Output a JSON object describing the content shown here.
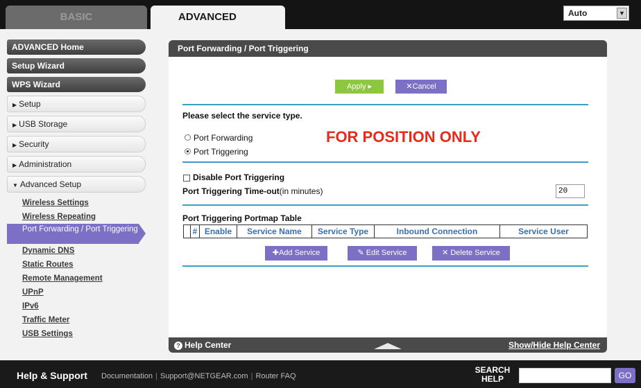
{
  "tabs": {
    "basic": "BASIC",
    "advanced": "ADVANCED"
  },
  "language": {
    "selected": "Auto"
  },
  "sidebar": {
    "top_buttons": [
      "ADVANCED Home",
      "Setup Wizard",
      "WPS Wizard"
    ],
    "sections": [
      "Setup",
      "USB Storage",
      "Security",
      "Administration",
      "Advanced Setup"
    ],
    "sublinks": [
      "Wireless Settings",
      "Wireless Repeating",
      "Port Forwarding / Port Triggering",
      "Dynamic DNS",
      "Static Routes",
      "Remote Management",
      "UPnP",
      "IPv6",
      "Traffic Meter",
      "USB Settings"
    ],
    "active_sublink": "Port Forwarding / Port Triggering"
  },
  "panel": {
    "title": "Port Forwarding / Port Triggering",
    "apply_label": "Apply ▸",
    "cancel_label": "✕Cancel",
    "service_type_prompt": "Please select the service type.",
    "radio_forwarding": "Port Forwarding",
    "radio_triggering": "Port Triggering",
    "selected_service": "Port Triggering",
    "watermark": "FOR POSITION ONLY",
    "disable_label": "Disable Port Triggering",
    "timeout_label_bold": "Port Triggering Time-out",
    "timeout_label_unit": "(in minutes)",
    "timeout_value": "20",
    "table_title": "Port Triggering Portmap Table",
    "table_headers": [
      "",
      "#",
      "Enable",
      "Service Name",
      "Service Type",
      "Inbound Connection",
      "Service User"
    ],
    "add_service": "Add Service",
    "edit_service": "Edit Service",
    "delete_service": "Delete Service",
    "help_center": "Help Center",
    "show_hide_help": "Show/Hide Help Center"
  },
  "footer": {
    "help_support": "Help & Support",
    "links": [
      "Documentation",
      "Support@NETGEAR.com",
      "Router FAQ"
    ],
    "search_label": "SEARCH HELP",
    "go_label": "GO"
  },
  "colors": {
    "accent_purple": "#7b6fc6",
    "apply_green": "#8dc63f",
    "rule_blue": "#3a9ec2",
    "watermark_red": "#e8291c"
  }
}
